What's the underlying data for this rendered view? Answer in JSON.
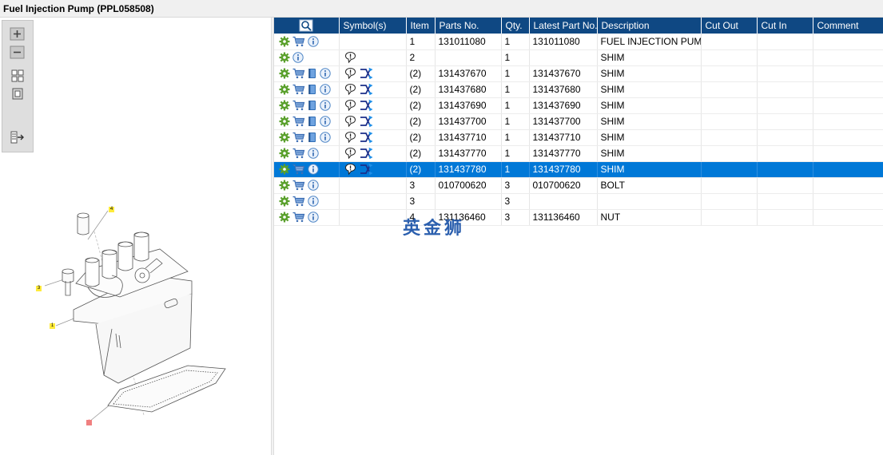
{
  "title": "Fuel Injection Pump (PPL058508)",
  "toolbar": {
    "buttons": [
      {
        "name": "zoom-in-icon"
      },
      {
        "name": "zoom-out-icon"
      },
      {
        "name": "fit-all-icon"
      },
      {
        "name": "fit-window-icon"
      },
      {
        "name": "export-list-icon"
      }
    ]
  },
  "callouts": [
    "4",
    "3",
    "1",
    "2"
  ],
  "grid": {
    "columns": [
      "",
      "Symbol(s)",
      "Item",
      "Parts No.",
      "Qty.",
      "Latest Part No.",
      "Description",
      "Cut Out",
      "Cut In",
      "Comment"
    ],
    "rows": [
      {
        "icons": [
          "gear",
          "cart",
          "info"
        ],
        "symbols": [],
        "item": "1",
        "parts_no": "131011080",
        "qty": "1",
        "latest": "131011080",
        "desc": "FUEL INJECTION PUMP",
        "selected": false
      },
      {
        "icons": [
          "gear",
          "info"
        ],
        "symbols": [
          "comment"
        ],
        "item": "2",
        "parts_no": "",
        "qty": "1",
        "latest": "",
        "desc": "SHIM",
        "selected": false
      },
      {
        "icons": [
          "gear",
          "cart",
          "book",
          "info"
        ],
        "symbols": [
          "comment",
          "swap"
        ],
        "item": "(2)",
        "parts_no": "131437670",
        "qty": "1",
        "latest": "131437670",
        "desc": "SHIM",
        "selected": false
      },
      {
        "icons": [
          "gear",
          "cart",
          "book",
          "info"
        ],
        "symbols": [
          "comment",
          "swap"
        ],
        "item": "(2)",
        "parts_no": "131437680",
        "qty": "1",
        "latest": "131437680",
        "desc": "SHIM",
        "selected": false
      },
      {
        "icons": [
          "gear",
          "cart",
          "book",
          "info"
        ],
        "symbols": [
          "comment",
          "swap"
        ],
        "item": "(2)",
        "parts_no": "131437690",
        "qty": "1",
        "latest": "131437690",
        "desc": "SHIM",
        "selected": false
      },
      {
        "icons": [
          "gear",
          "cart",
          "book",
          "info"
        ],
        "symbols": [
          "comment",
          "swap"
        ],
        "item": "(2)",
        "parts_no": "131437700",
        "qty": "1",
        "latest": "131437700",
        "desc": "SHIM",
        "selected": false
      },
      {
        "icons": [
          "gear",
          "cart",
          "book",
          "info"
        ],
        "symbols": [
          "comment",
          "swap"
        ],
        "item": "(2)",
        "parts_no": "131437710",
        "qty": "1",
        "latest": "131437710",
        "desc": "SHIM",
        "selected": false
      },
      {
        "icons": [
          "gear",
          "cart",
          "info"
        ],
        "symbols": [
          "comment",
          "swap"
        ],
        "item": "(2)",
        "parts_no": "131437770",
        "qty": "1",
        "latest": "131437770",
        "desc": "SHIM",
        "selected": false
      },
      {
        "icons": [
          "gear",
          "cart",
          "info"
        ],
        "symbols": [
          "comment",
          "swap"
        ],
        "item": "(2)",
        "parts_no": "131437780",
        "qty": "1",
        "latest": "131437780",
        "desc": "SHIM",
        "selected": true
      },
      {
        "icons": [
          "gear",
          "cart",
          "info"
        ],
        "symbols": [],
        "item": "3",
        "parts_no": "010700620",
        "qty": "3",
        "latest": "010700620",
        "desc": "BOLT",
        "selected": false
      },
      {
        "icons": [
          "gear",
          "cart",
          "info"
        ],
        "symbols": [],
        "item": "3",
        "parts_no": "",
        "qty": "3",
        "latest": "",
        "desc": "",
        "selected": false
      },
      {
        "icons": [
          "gear",
          "cart",
          "info"
        ],
        "symbols": [],
        "item": "4",
        "parts_no": "131136460",
        "qty": "3",
        "latest": "131136460",
        "desc": "NUT",
        "selected": false
      }
    ]
  },
  "watermark": "英金狮",
  "colors": {
    "header": "#0f4883",
    "selected": "#0078d7",
    "gear": "#5aa02c",
    "cart": "#3d6fb5",
    "info": "#4f86c6"
  }
}
